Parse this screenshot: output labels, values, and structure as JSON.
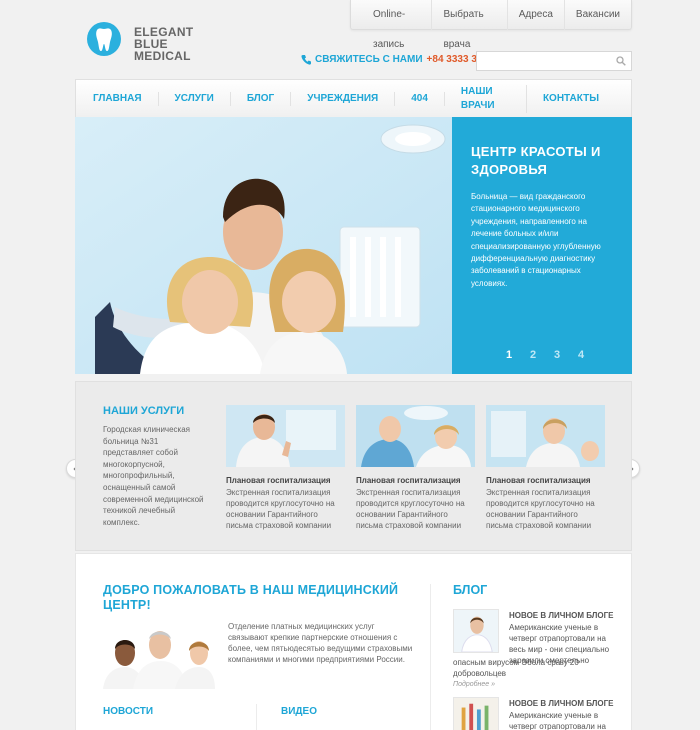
{
  "toplinks": [
    "Online-запись",
    "Выбрать врача",
    "Адреса",
    "Вакансии"
  ],
  "logo": {
    "line1": "ELEGANT",
    "line2": "BLUE",
    "line3": "MEDICAL"
  },
  "contact": {
    "label": "СВЯЖИТЕСЬ С НАМИ",
    "phone": "+84 3333 3333"
  },
  "search": {
    "placeholder": ""
  },
  "nav": [
    "ГЛАВНАЯ",
    "УСЛУГИ",
    "БЛОГ",
    "УЧРЕЖДЕНИЯ",
    "404",
    "НАШИ ВРАЧИ",
    "КОНТАКТЫ"
  ],
  "hero": {
    "title": "ЦЕНТР КРАСОТЫ И ЗДОРОВЬЯ",
    "text": "Больница — вид гражданского стационарного медицинского учреждения, направленного на лечение больных и/или специализированную углубленную дифференциальную диагностику заболеваний в стационарных условиях.",
    "pages": [
      "1",
      "2",
      "3",
      "4"
    ]
  },
  "services": {
    "title": "НАШИ УСЛУГИ",
    "text": "Городская клиническая больница №31 представляет собой многокорпусной, многопрофильный, оснащенный самой современной медицинской техникой лечебный комплекс.",
    "cards": [
      {
        "title": "Плановая госпитализация",
        "text": "Экстренная госпитализация проводится круглосуточно на основании Гарантийного письма страховой компании"
      },
      {
        "title": "Плановая госпитализация",
        "text": "Экстренная госпитализация проводится круглосуточно на основании Гарантийного письма страховой компании"
      },
      {
        "title": "Плановая госпитализация",
        "text": "Экстренная госпитализация проводится круглосуточно на основании Гарантийного письма страховой компании"
      }
    ]
  },
  "welcome": {
    "title": "ДОБРО ПОЖАЛОВАТЬ В НАШ МЕДИЦИНСКИЙ ЦЕНТР!",
    "text": "Отделение платных медицинских услуг связывают крепкие партнерские отношения с более, чем пятьюдесятью ведущими страховыми компаниями и многими предприятиями России."
  },
  "news_title": "НОВОСТИ",
  "video_title": "ВИДЕО",
  "blog": {
    "title": "БЛОГ",
    "items": [
      {
        "heading": "НОВОЕ В ЛИЧНОМ БЛОГЕ",
        "text": "Американские ученые в четверг отрапортовали на весь мир - они специально заразили смертельно",
        "text2": "опасным вирусом Эбола сразу 20 добровольцев",
        "more": "Подробнее »"
      },
      {
        "heading": "НОВОЕ В ЛИЧНОМ БЛОГЕ",
        "text": "Американские ученые в четверг отрапортовали на",
        "text2": "",
        "more": ""
      }
    ]
  },
  "colors": {
    "accent": "#1ea6d6",
    "hero_panel": "#22aad8",
    "phone": "#e05a2a"
  }
}
